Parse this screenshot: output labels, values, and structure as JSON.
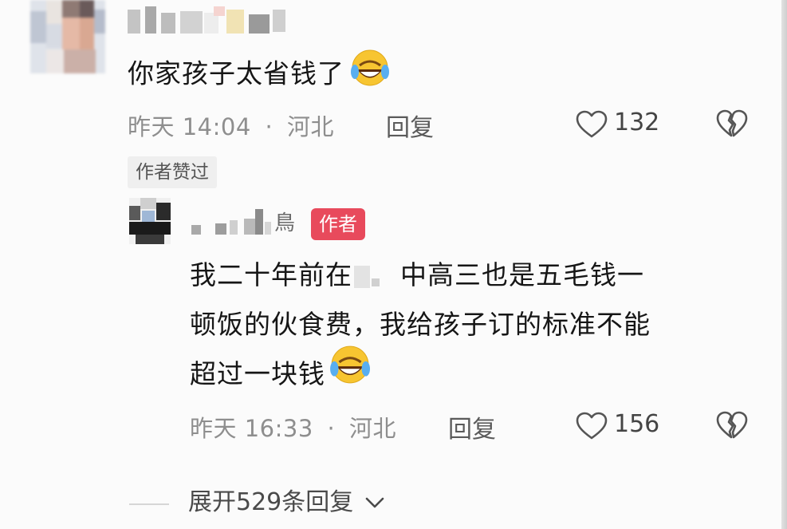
{
  "comment": {
    "text": "你家孩子太省钱了",
    "emoji": "laughing-crying-emoji",
    "time": "昨天 14:04",
    "separator": "·",
    "location": "河北",
    "reply_label": "回复",
    "like_count": "132",
    "author_liked_tag": "作者赞过"
  },
  "reply": {
    "name_suffix": "鳥",
    "author_badge": "作者",
    "text_line_1_a": "我二十年前在",
    "text_line_1_b": "中高三也是五毛钱一",
    "text_line_2": "顿饭的伙食费，我给孩子订的标准不能",
    "text_line_3": "超过一块钱",
    "emoji": "laughing-crying-emoji",
    "time": "昨天 16:33",
    "separator": "·",
    "location": "河北",
    "reply_label": "回复",
    "like_count": "156"
  },
  "expand": {
    "label": "展开529条回复"
  },
  "icons": {
    "like": "heart-outline-icon",
    "dislike": "broken-heart-icon",
    "expand": "chevron-down-icon"
  },
  "colors": {
    "author_badge_bg": "#e84a5c",
    "meta_text": "#8e8e8e",
    "emoji_yellow": "#f7c531",
    "emoji_tear_blue": "#58aef0"
  }
}
